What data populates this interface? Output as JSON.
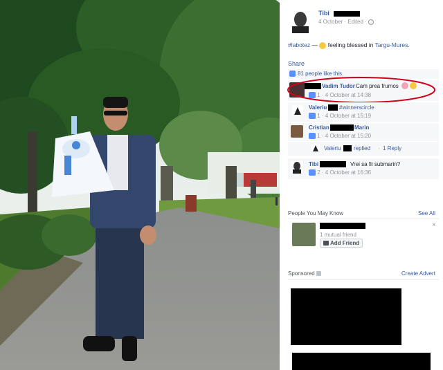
{
  "post": {
    "author": "Tibi",
    "date": "4 October",
    "edited": "Edited",
    "hashtag": "#labotez",
    "dash": "—",
    "feeling": "feeling blessed in",
    "place": "Targu-Mures",
    "period": ".",
    "share": "Share",
    "likes": "81 people like this."
  },
  "comments": [
    {
      "name": "Vadim Tudor",
      "text": "Cam prea frumos",
      "likes": "1",
      "time": "4 October at 14:38"
    },
    {
      "name": "Valeriu",
      "text": "#winnerscircle",
      "likes": "1",
      "time": "4 October at 15:19"
    },
    {
      "name": "Cristian",
      "name2": "Marin",
      "text": "",
      "likes": "1",
      "time": "4 October at 15:20"
    },
    {
      "name": "Tibi",
      "text": "Vrei sa fii submarin?",
      "likes": "2",
      "time": "4 October at 16:36"
    }
  ],
  "reply": {
    "name": "Valeriu",
    "replied": "replied",
    "dot": "·",
    "count": "1 Reply"
  },
  "people": {
    "title": "People You May Know",
    "see_all": "See All",
    "close": "×",
    "mutual": "1 mutual friend",
    "add_friend": "Add Friend"
  },
  "sponsored": {
    "title": "Sponsored",
    "create": "Create Advert"
  },
  "colors": {
    "link": "#365899",
    "highlight": "#d0021b",
    "panel": "#f6f7f9"
  },
  "icons": [
    "globe-icon",
    "smile-icon",
    "like-icon",
    "heart-emoji-icon",
    "smile-emoji-icon",
    "add-friend-icon",
    "sponsored-badge-icon"
  ]
}
